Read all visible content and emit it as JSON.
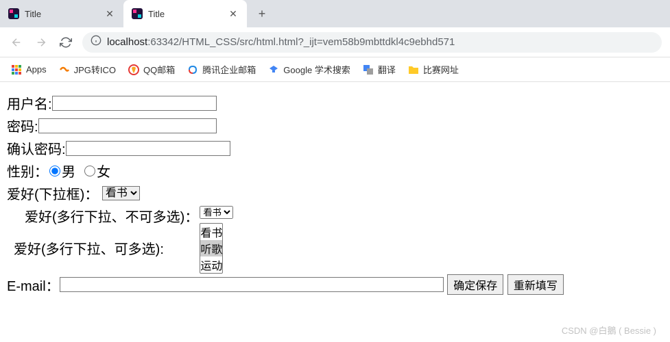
{
  "tabs": {
    "tab1": {
      "title": "Title"
    },
    "tab2": {
      "title": "Title"
    }
  },
  "url": {
    "prefix": "localhost",
    "rest": ":63342/HTML_CSS/src/html.html?_ijt=vem58b9mbttdkl4c9ebhd571"
  },
  "bookmarks": {
    "apps": "Apps",
    "jpg": "JPG转ICO",
    "qq": "QQ邮箱",
    "tencent": "腾讯企业邮箱",
    "google": "Google 学术搜索",
    "translate": "翻译",
    "contest": "比赛网址"
  },
  "form": {
    "username_label": "用户名:",
    "password_label": "密码:",
    "confirm_label": "确认密码:",
    "gender_label": "性别：",
    "gender_male": "男",
    "gender_female": "女",
    "hobby_select_label": "爱好(下拉框)：",
    "hobby_multi_nosel_label": "爱好(多行下拉、不可多选)：",
    "hobby_multi_sel_label": "爱好(多行下拉、可多选):",
    "hobby_options": {
      "read": "看书",
      "listen": "听歌",
      "sport": "运动"
    },
    "email_label": "E-mail：",
    "submit": "确定保存",
    "reset": "重新填写"
  },
  "watermark": "CSDN @白鵝 ( Bessie )"
}
